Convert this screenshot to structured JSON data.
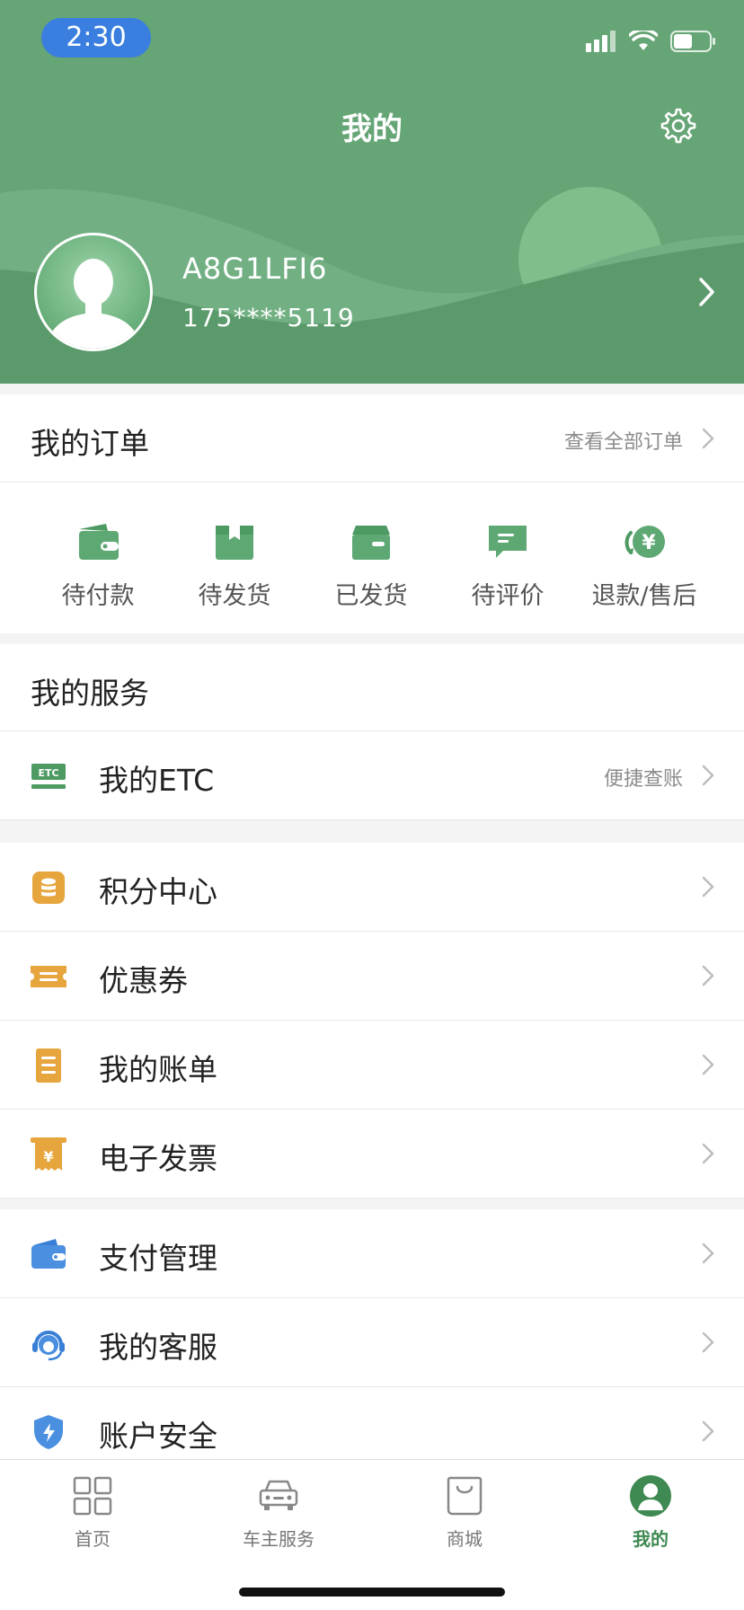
{
  "status_bar": {
    "time": "2:30"
  },
  "header": {
    "title": "我的",
    "username": "A8G1LFI6",
    "phone": "175****5119",
    "colors": {
      "bg": "#66a576",
      "hill_light": "#72b084",
      "hill_dark": "#5a9a6b",
      "sun": "#7ebf8c"
    }
  },
  "orders": {
    "title": "我的订单",
    "view_all": "查看全部订单",
    "items": [
      {
        "label": "待付款",
        "icon": "wallet-icon"
      },
      {
        "label": "待发货",
        "icon": "box-icon"
      },
      {
        "label": "已发货",
        "icon": "shipped-box-icon"
      },
      {
        "label": "待评价",
        "icon": "comment-icon"
      },
      {
        "label": "退款/售后",
        "icon": "refund-icon"
      }
    ]
  },
  "services": {
    "title": "我的服务",
    "etc": {
      "label": "我的ETC",
      "right": "便捷查账",
      "icon": "etc-icon"
    }
  },
  "menu_group1": [
    {
      "label": "积分中心",
      "icon": "points-icon"
    },
    {
      "label": "优惠券",
      "icon": "coupon-icon"
    },
    {
      "label": "我的账单",
      "icon": "bill-icon"
    },
    {
      "label": "电子发票",
      "icon": "invoice-icon"
    }
  ],
  "menu_group2": [
    {
      "label": "支付管理",
      "icon": "payment-wallet-icon"
    },
    {
      "label": "我的客服",
      "icon": "customer-service-icon"
    },
    {
      "label": "账户安全",
      "icon": "shield-icon"
    }
  ],
  "tabbar": [
    {
      "label": "首页",
      "icon": "grid-icon"
    },
    {
      "label": "车主服务",
      "icon": "car-icon"
    },
    {
      "label": "商城",
      "icon": "shopping-bag-icon"
    },
    {
      "label": "我的",
      "icon": "profile-icon",
      "active": true
    }
  ]
}
